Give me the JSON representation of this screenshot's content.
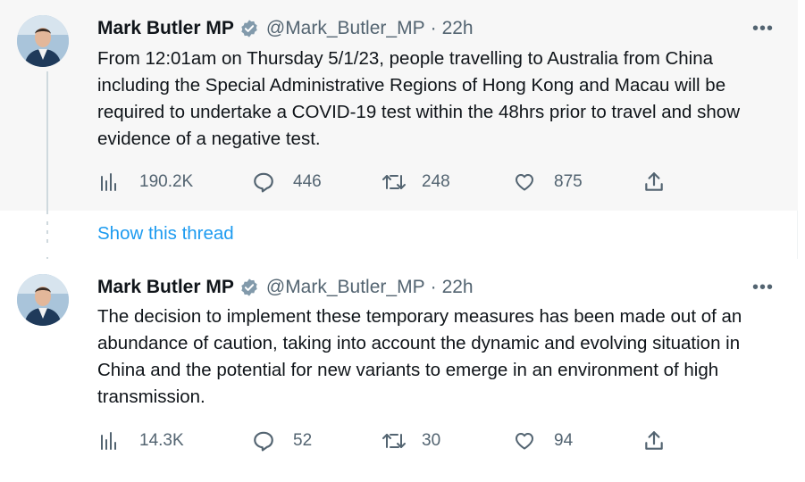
{
  "tweets": [
    {
      "author": {
        "name": "Mark Butler MP",
        "handle": "@Mark_Butler_MP",
        "separator": "·",
        "time": "22h"
      },
      "text": "From 12:01am on Thursday 5/1/23, people travelling to Australia from China including the Special Administrative Regions of Hong Kong and Macau will be required to undertake a COVID-19 test within the 48hrs prior to travel and show evidence of a negative test.",
      "stats": {
        "views": "190.2K",
        "replies": "446",
        "retweets": "248",
        "likes": "875"
      }
    },
    {
      "author": {
        "name": "Mark Butler MP",
        "handle": "@Mark_Butler_MP",
        "separator": "·",
        "time": "22h"
      },
      "text": "The decision to implement these temporary measures has been made out of an abundance of caution, taking into account the dynamic and evolving situation in China and the potential for new variants to emerge in an environment of high transmission.",
      "stats": {
        "views": "14.3K",
        "replies": "52",
        "retweets": "30",
        "likes": "94"
      }
    }
  ],
  "thread": {
    "show_label": "Show this thread"
  },
  "icons": {
    "verified": "verified-badge-icon",
    "more": "more-horizontal-icon",
    "views": "analytics-icon",
    "reply": "reply-icon",
    "retweet": "retweet-icon",
    "like": "heart-icon",
    "share": "share-icon"
  },
  "colors": {
    "link": "#1d9bf0",
    "muted": "#536471",
    "text": "#0f1419",
    "hover_bg": "#f7f7f7"
  }
}
